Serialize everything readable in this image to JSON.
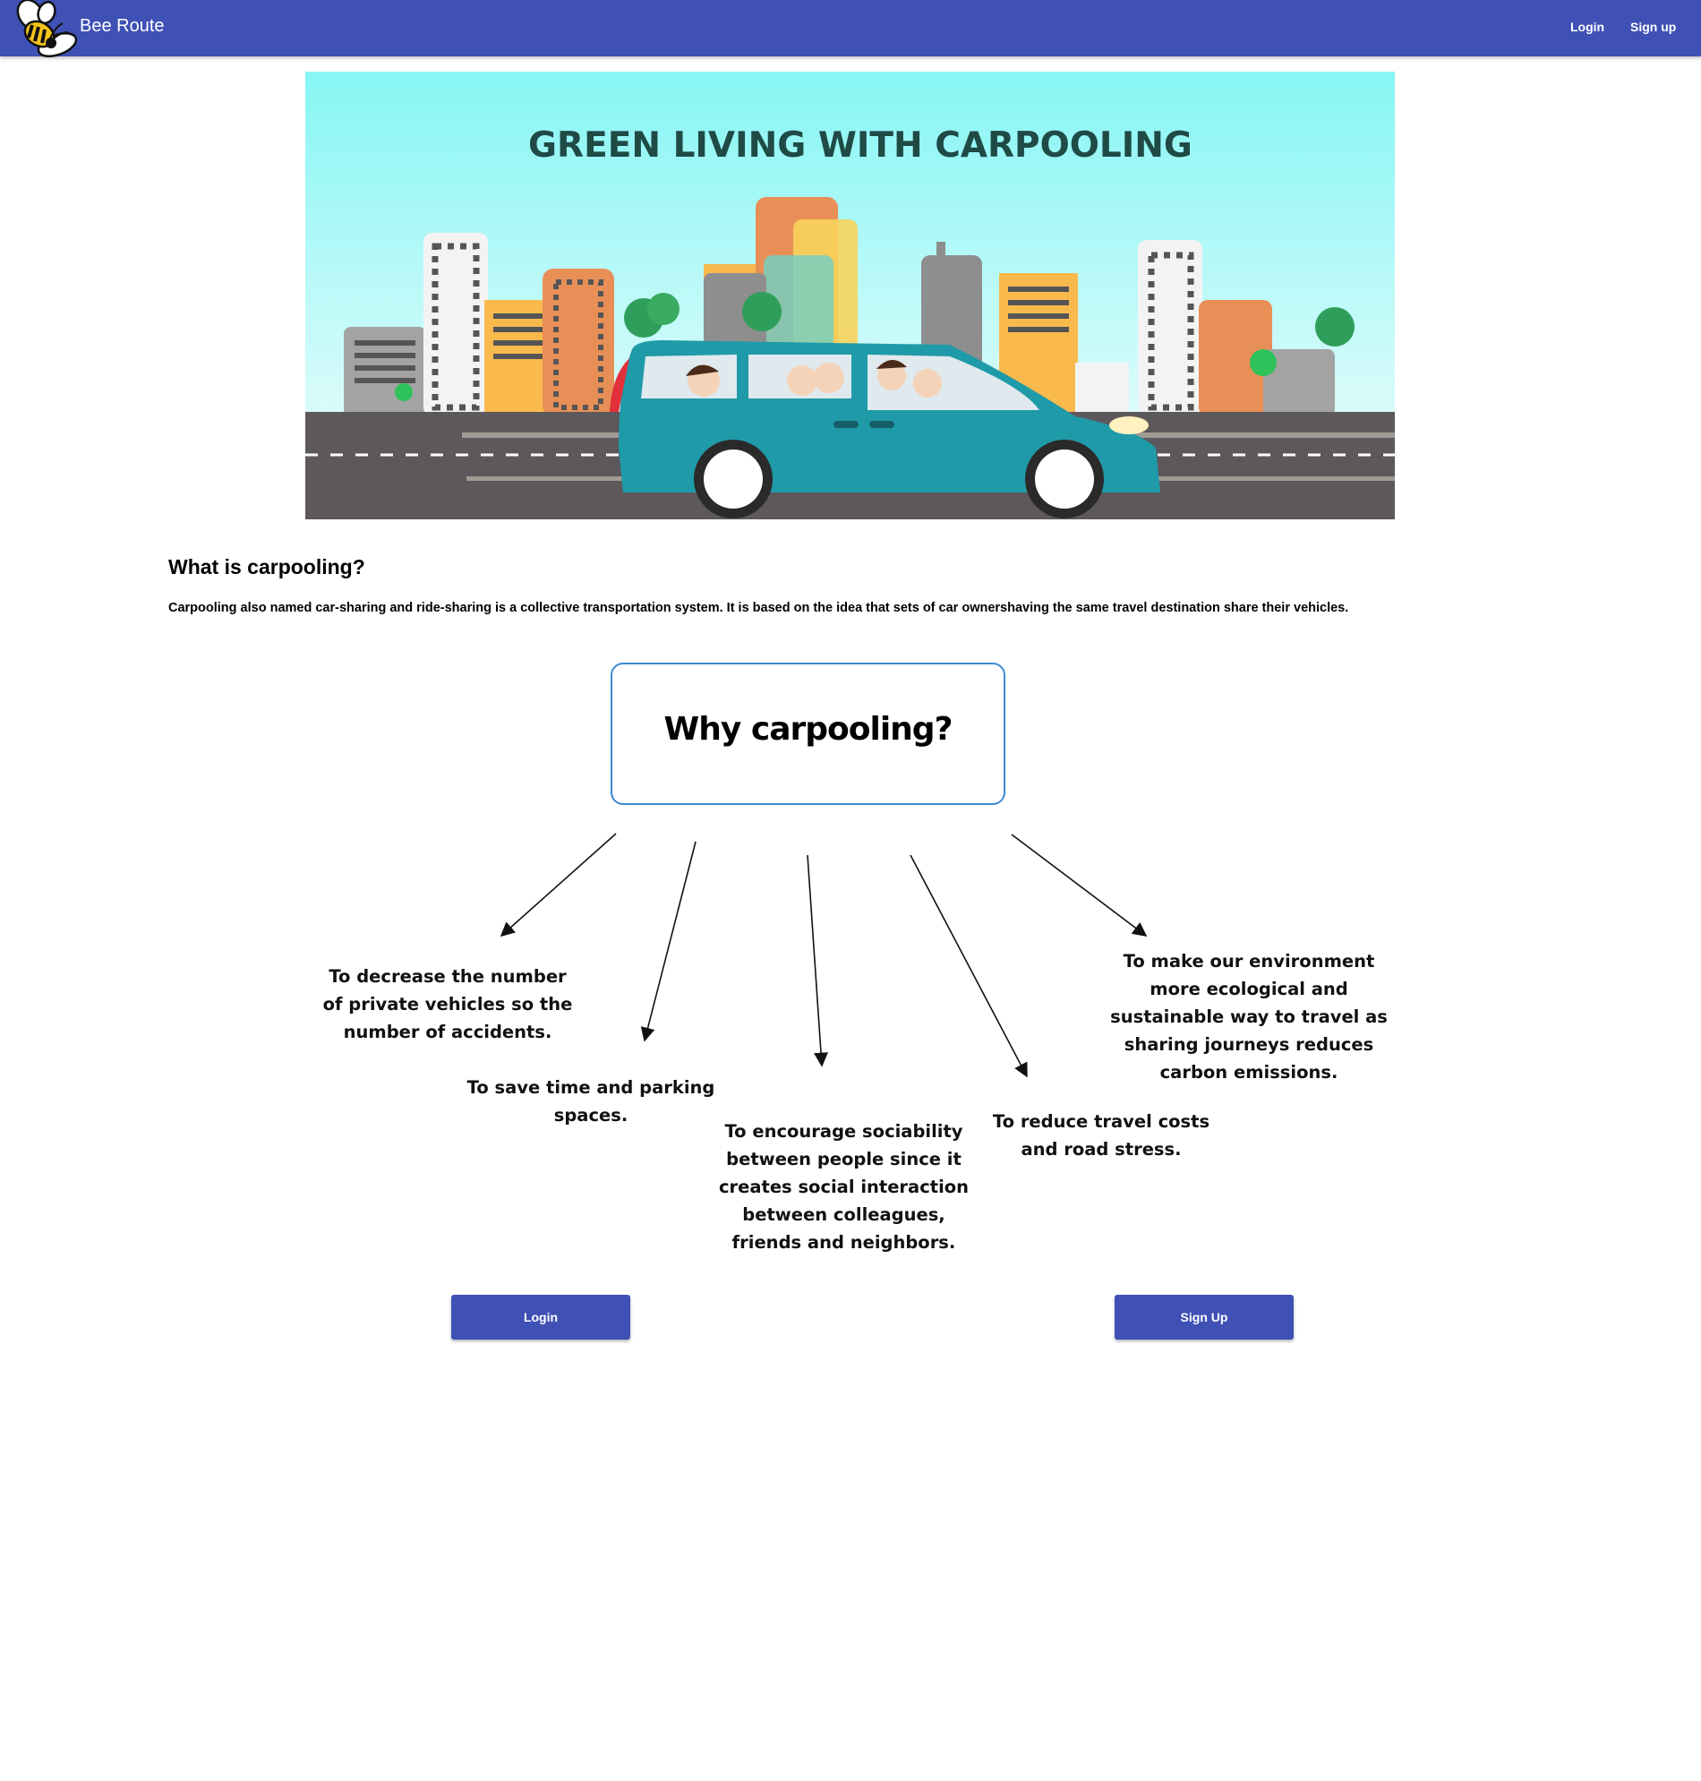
{
  "header": {
    "brand": "Bee Route",
    "logo_icon": "bee-logo-icon",
    "nav": {
      "login": "Login",
      "signup": "Sign up"
    },
    "colors": {
      "bar": "#3f51b5",
      "text": "#ffffff"
    }
  },
  "hero": {
    "title": "GREEN LIVING WITH CARPOOLING"
  },
  "about": {
    "heading": "What is carpooling?",
    "body": "Carpooling also named car-sharing and ride-sharing is a collective transportation system. It is based on the idea that sets of car ownershaving the same travel destination share their vehicles."
  },
  "diagram": {
    "center": "Why carpooling?",
    "reasons": [
      "To decrease the number of private vehicles so the number of accidents.",
      "To save time and parking spaces.",
      "To encourage sociability between people since it creates social interaction between colleagues, friends and neighbors.",
      "To reduce travel costs and road stress.",
      "To make our environment more ecological and sustainable way to travel as sharing journeys reduces carbon emissions."
    ],
    "box_color": "#3b8ad1"
  },
  "actions": {
    "login": "Login",
    "signup": "Sign Up",
    "button_color": "#3f51b5"
  }
}
